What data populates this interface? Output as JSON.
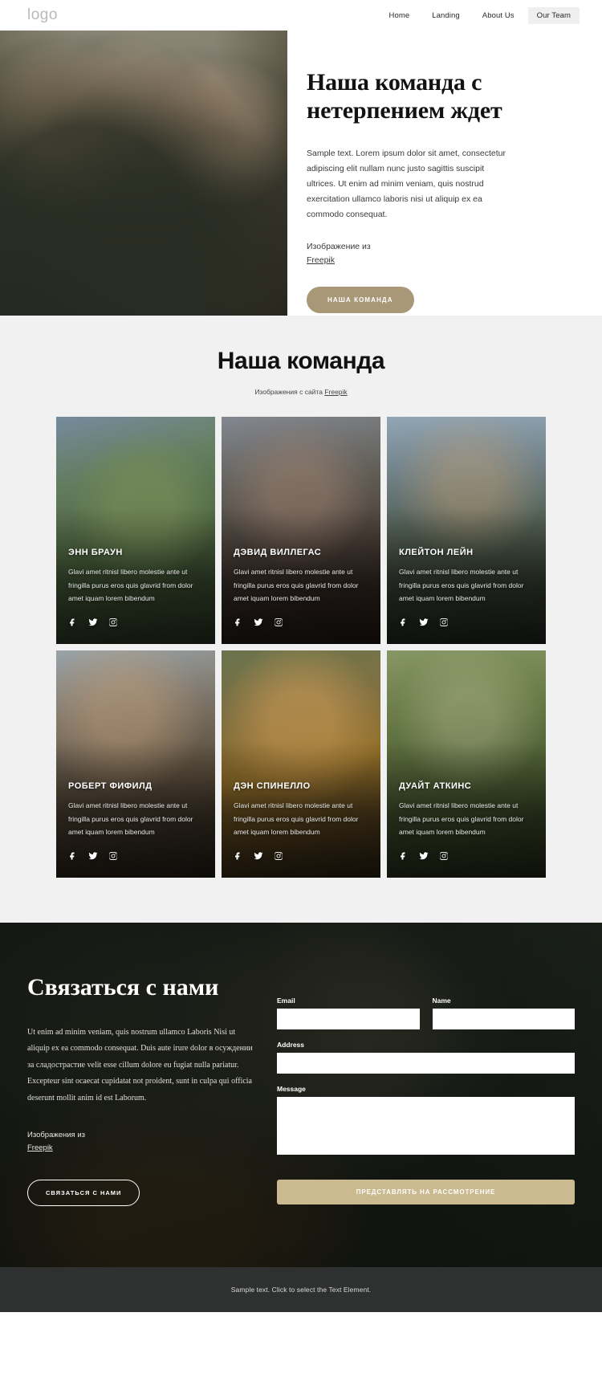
{
  "header": {
    "logo": "logo",
    "nav": [
      {
        "label": "Home",
        "active": false
      },
      {
        "label": "Landing",
        "active": false
      },
      {
        "label": "About Us",
        "active": false
      },
      {
        "label": "Our Team",
        "active": true
      }
    ]
  },
  "hero": {
    "title": "Наша команда с нетерпением ждет",
    "paragraph": "Sample text. Lorem ipsum dolor sit amet, consectetur adipiscing elit nullam nunc justo sagittis suscipit ultrices. Ut enim ad minim veniam, quis nostrud exercitation ullamco laboris nisi ut aliquip ex ea commodo consequat.",
    "credit_text": "Изображение из",
    "credit_link": "Freepik",
    "cta_label": "НАША КОМАНДА",
    "cta_color": "#a89878"
  },
  "team": {
    "title": "Наша команда",
    "subtitle_prefix": "Изображения с сайта ",
    "subtitle_link": "Freepik",
    "member_description": "Glavi amet ritnisl libero molestie ante ut fringilla purus eros quis glavrid from dolor amet iquam lorem bibendum",
    "socials": [
      "facebook-icon",
      "twitter-icon",
      "instagram-icon"
    ],
    "members": [
      {
        "name": "ЭНН БРАУН"
      },
      {
        "name": "ДЭВИД ВИЛЛЕГАС"
      },
      {
        "name": "КЛЕЙТОН ЛЕЙН"
      },
      {
        "name": "РОБЕРТ ФИФИЛД"
      },
      {
        "name": "ДЭН СПИНЕЛЛО"
      },
      {
        "name": "ДУАЙТ АТКИНС"
      }
    ]
  },
  "contact": {
    "title": "Связаться с нами",
    "paragraph": "Ut enim ad minim veniam, quis nostrum ullamco Laboris Nisi ut aliquip ex ea commodo consequat. Duis aute irure dolor в осуждении за сладострастие velit esse cillum dolore eu fugiat nulla pariatur. Excepteur sint ocaecat cupidatat not proident, sunt in culpa qui officia deserunt mollit anim id est Laborum.",
    "credit_text": "Изображения из",
    "credit_link": "Freepik",
    "cta_label": "СВЯЗАТЬСЯ С НАМИ",
    "form": {
      "email_label": "Email",
      "email_value": "",
      "name_label": "Name",
      "name_value": "",
      "address_label": "Address",
      "address_value": "",
      "message_label": "Message",
      "message_value": "",
      "submit_label": "ПРЕДСТАВЛЯТЬ НА РАССМОТРЕНИЕ",
      "submit_color": "#cbb98f"
    }
  },
  "footer": {
    "text": "Sample text. Click to select the Text Element."
  }
}
